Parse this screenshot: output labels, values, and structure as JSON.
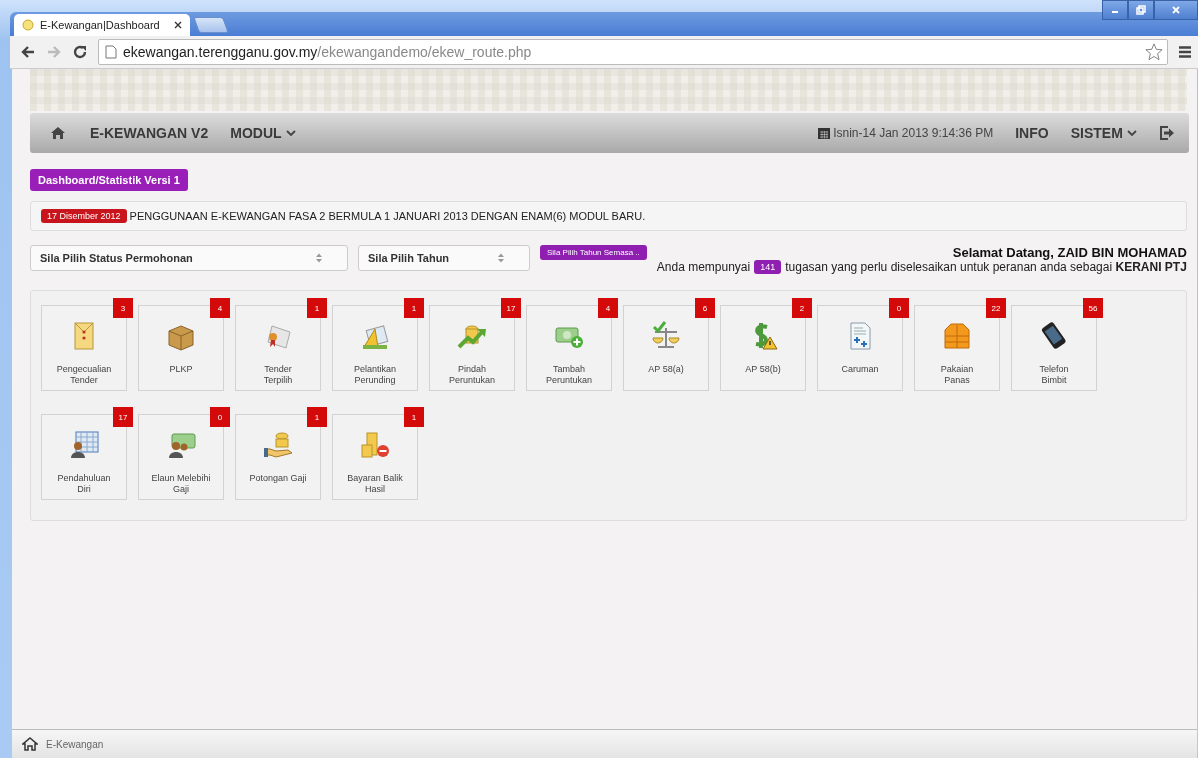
{
  "browser": {
    "tab_title": "E-Kewangan|Dashboard",
    "url_host": "ekewangan.terengganu.gov.my",
    "url_path": "/ekewangandemo/ekew_route.php"
  },
  "navbar": {
    "brand": "E-KEWANGAN V2",
    "menus": [
      {
        "label": "MODUL",
        "kind": "dropdown"
      }
    ],
    "datetime": "Isnin-14 Jan 2013 9:14:36 PM",
    "right_menus": [
      {
        "label": "INFO",
        "kind": "link"
      },
      {
        "label": "SISTEM",
        "kind": "dropdown"
      }
    ]
  },
  "page_badge": "Dashboard/Statistik Versi 1",
  "announcement": {
    "date": "17 Disember 2012",
    "text": "PENGGUNAAN E-KEWANGAN FASA 2 BERMULA 1 JANUARI 2013 DENGAN ENAM(6) MODUL BARU."
  },
  "filters": [
    {
      "value": "Sila Pilih Status Permohonan"
    },
    {
      "value": "Sila Pilih Tahun"
    }
  ],
  "year_button": "Sila Pilih Tahun Semasa ..",
  "welcome": {
    "greeting": "Selamat Datang, ZAID BIN MOHAMAD",
    "before": "Anda mempunyai",
    "count": "141",
    "after": "tugasan yang perlu diselesaikan untuk peranan anda sebagai **KERANI PTJ**"
  },
  "tiles": [
    [
      {
        "label": "Pengecualian\nTender",
        "count": "3"
      },
      {
        "label": "PLKP",
        "count": "4"
      },
      {
        "label": "Tender\nTerpilih",
        "count": "1"
      },
      {
        "label": "Pelantikan\nPerunding",
        "count": "1"
      },
      {
        "label": "Pindah\nPeruntukan",
        "count": "17"
      },
      {
        "label": "Tambah\nPeruntukan",
        "count": "4"
      },
      {
        "label": "AP 58(a)",
        "count": "6"
      },
      {
        "label": "AP 58(b)",
        "count": "2"
      },
      {
        "label": "Caruman",
        "count": "0"
      },
      {
        "label": "Pakaian\nPanas",
        "count": "22"
      },
      {
        "label": "Telefon\nBimbit",
        "count": "56"
      }
    ],
    [
      {
        "label": "Pendahuluan\nDiri",
        "count": "17"
      },
      {
        "label": "Elaun Melebihi\nGaji",
        "count": "0"
      },
      {
        "label": "Potongan Gaji",
        "count": "1"
      },
      {
        "label": "Bayaran Balik\nHasil",
        "count": "1"
      }
    ]
  ],
  "footer": {
    "breadcrumb": "E-Kewangan"
  }
}
